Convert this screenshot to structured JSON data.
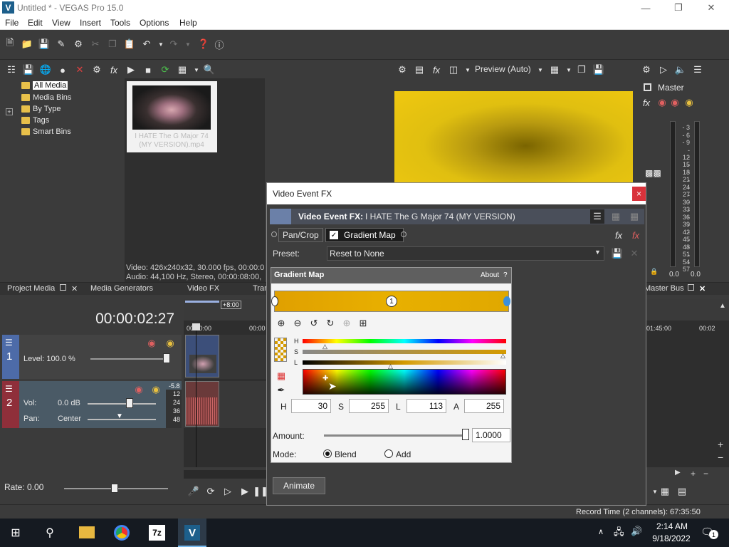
{
  "window": {
    "title": "Untitled * - VEGAS Pro 15.0",
    "app_icon": "V"
  },
  "menu": [
    "File",
    "Edit",
    "View",
    "Insert",
    "Tools",
    "Options",
    "Help"
  ],
  "project_media": {
    "tree": [
      "All Media",
      "Media Bins",
      "By Type",
      "Tags",
      "Smart Bins"
    ],
    "thumbnail_caption": "I HATE The G Major 74 (MY VERSION).mp4",
    "info_line1": "Video: 426x240x32, 30.000 fps, 00:00:0",
    "info_line2": "Audio: 44,100 Hz, Stereo, 00:00:08:00,"
  },
  "preview": {
    "mode": "Preview (Auto)"
  },
  "master": {
    "label": "Master",
    "scale": [
      "3",
      "6",
      "9",
      "12",
      "15",
      "18",
      "21",
      "24",
      "27",
      "30",
      "33",
      "36",
      "39",
      "42",
      "45",
      "48",
      "51",
      "54",
      "57"
    ],
    "left_value": "0.0",
    "right_value": "0.0"
  },
  "tabs": {
    "project_media": "Project Media",
    "media_generators": "Media Generators",
    "video_fx": "Video FX",
    "transitions": "Tran",
    "master_bus": "Master Bus"
  },
  "timeline": {
    "timecode": "00:00:02:27",
    "ruler_offset": "+8:00",
    "ruler_labels": [
      "00:00:00",
      "00:00",
      "01:45:00",
      "00:02"
    ],
    "track1": {
      "number": "1",
      "level_label": "Level: 100.0 %"
    },
    "track2": {
      "number": "2",
      "vol_label": "Vol:",
      "vol_value": "0.0 dB",
      "pan_label": "Pan:",
      "pan_value": "Center",
      "meter_value": "-5.8",
      "meter_scale": [
        "12",
        "24",
        "36",
        "48"
      ]
    }
  },
  "bottom": {
    "rate": "Rate: 0.00"
  },
  "status": {
    "record_time": "Record Time (2 channels): 67:35:50"
  },
  "taskbar": {
    "time": "2:14 AM",
    "date": "9/18/2022",
    "notif_count": "1"
  },
  "dialog": {
    "title": "Video Event FX",
    "close": "×",
    "fx_label": "Video Event FX:",
    "fx_name": "I HATE The G Major 74 (MY VERSION)",
    "chain": {
      "item1": "Pan/Crop",
      "item2": "Gradient Map"
    },
    "preset_label": "Preset:",
    "preset_value": "Reset to None",
    "plugin_title": "Gradient Map",
    "about": "About",
    "help": "?",
    "marker_label": "1",
    "hsl_labels": {
      "h": "H",
      "s": "S",
      "l": "L"
    },
    "fields": {
      "h_label": "H",
      "h_value": "30",
      "s_label": "S",
      "s_value": "255",
      "l_label": "L",
      "l_value": "113",
      "a_label": "A",
      "a_value": "255"
    },
    "amount_label": "Amount:",
    "amount_value": "1.0000",
    "amount_fraction": 1.0,
    "mode_label": "Mode:",
    "mode_blend": "Blend",
    "mode_add": "Add",
    "animate": "Animate"
  },
  "colors": {
    "accent_yellow": "#e8b400",
    "track_video": "#4d6ba8",
    "track_audio": "#8f2f3a",
    "close_red": "#d9323b"
  }
}
